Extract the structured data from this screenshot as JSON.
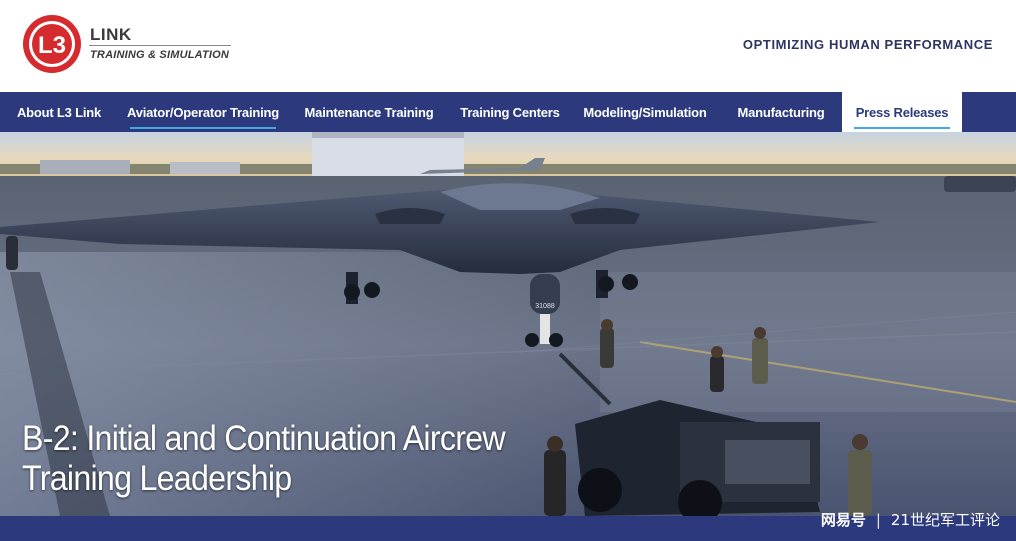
{
  "header": {
    "logo_text": "L3",
    "brand_name": "LINK",
    "brand_subtitle": "TRAINING & SIMULATION",
    "tagline": "OPTIMIZING HUMAN PERFORMANCE"
  },
  "nav": {
    "items": [
      {
        "label": "About L3 Link"
      },
      {
        "label": "Aviator/Operator Training"
      },
      {
        "label": "Maintenance Training"
      },
      {
        "label": "Training Centers"
      },
      {
        "label": "Modeling/Simulation"
      },
      {
        "label": "Manufacturing"
      },
      {
        "label": "Press Releases"
      }
    ],
    "active_index": 1
  },
  "hero": {
    "title_line1": "B-2: Initial and Continuation Aircrew",
    "title_line2": "Training Leadership",
    "aircraft_marking": "31088"
  },
  "watermark": {
    "logo": "网易号",
    "separator": "|",
    "source": "21世纪军工评论"
  },
  "colors": {
    "nav_bg": "#2c3a7d",
    "accent_underline": "#45a9e0",
    "logo_red": "#d52b2f",
    "tagline": "#2d3560"
  }
}
